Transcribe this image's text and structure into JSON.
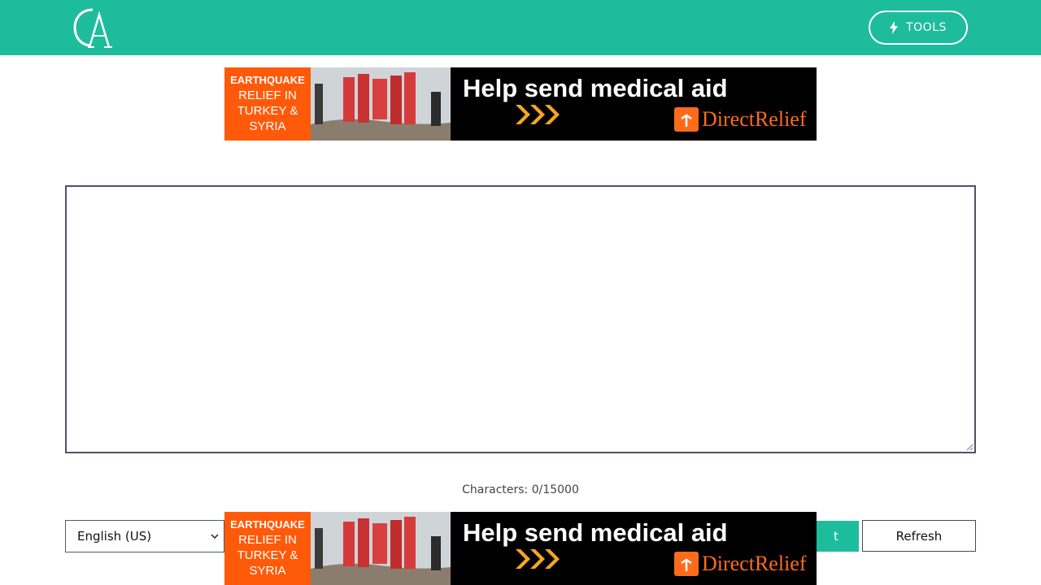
{
  "header": {
    "logo_alt": "CA logo",
    "tools_label": "TOOLS",
    "tools_icon": "bolt-icon",
    "brand_color": "#1dbc9c"
  },
  "ad_top": {
    "side_line1": "EARTHQUAKE",
    "side_line2": "RELIEF IN",
    "side_line3": "TURKEY &",
    "side_line4": "SYRIA",
    "headline": "Help send medical aid",
    "brand": "DirectRelief"
  },
  "ad_bottom": {
    "side_line1": "EARTHQUAKE",
    "side_line2": "RELIEF IN",
    "side_line3": "TURKEY &",
    "side_line4": "SYRIA",
    "headline": "Help send medical aid",
    "brand": "DirectRelief"
  },
  "editor": {
    "value": "",
    "placeholder": ""
  },
  "char_count": "Characters: 0/15000",
  "controls": {
    "language_selected": "English (US)",
    "select_label_visible": "t",
    "refresh_label": "Refresh"
  }
}
